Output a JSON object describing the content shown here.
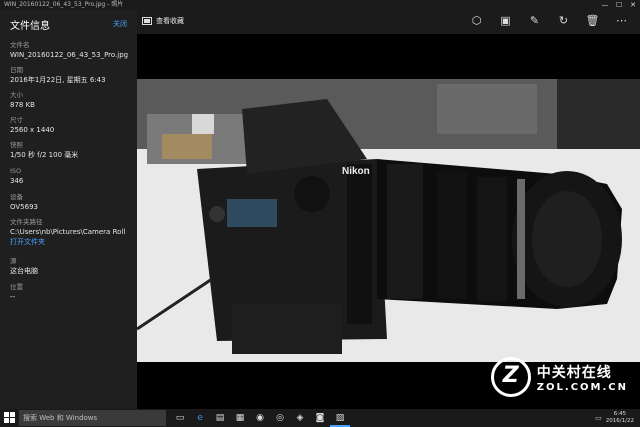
{
  "window": {
    "title": "WIN_20160122_06_43_53_Pro.jpg - 照片",
    "controls": [
      "—",
      "☐",
      "✕"
    ]
  },
  "panel": {
    "title": "文件信息",
    "close_label": "关闭",
    "fields": [
      {
        "key": "文件名",
        "value": "WIN_20160122_06_43_53_Pro.jpg"
      },
      {
        "key": "日期",
        "value": "2016年1月22日, 星期五 6:43"
      },
      {
        "key": "大小",
        "value": "878 KB"
      },
      {
        "key": "尺寸",
        "value": "2560 x 1440"
      },
      {
        "key": "快照",
        "value": "1/50 秒 f/2 100 毫米"
      },
      {
        "key": "ISO",
        "value": "346"
      },
      {
        "key": "设备",
        "value": "OV5693"
      },
      {
        "key": "文件夹路径",
        "value": "C:\\Users\\nb\\Pictures\\Camera Roll",
        "link": "打开文件夹"
      },
      {
        "key": "源",
        "value": "这台电脑"
      },
      {
        "key": "位置",
        "value": "--"
      }
    ]
  },
  "toolbar": {
    "favorite_label": "查看收藏",
    "favorite_icon": "folder-icon",
    "actions": [
      {
        "name": "enhance-icon",
        "glyph": "⬡"
      },
      {
        "name": "slideshow-icon",
        "glyph": "▣"
      },
      {
        "name": "edit-icon",
        "glyph": "✎"
      },
      {
        "name": "rotate-icon",
        "glyph": "↻"
      },
      {
        "name": "delete-icon",
        "glyph": "🗑"
      },
      {
        "name": "more-icon",
        "glyph": "⋯"
      }
    ]
  },
  "watermark": {
    "logo": "Z",
    "cn": "中关村在线",
    "en": "ZOL.COM.CN"
  },
  "taskbar": {
    "search_placeholder": "搜索 Web 和 Windows",
    "apps": [
      {
        "name": "task-view-icon",
        "glyph": "▭"
      },
      {
        "name": "edge-icon",
        "glyph": "e"
      },
      {
        "name": "explorer-icon",
        "glyph": "▤"
      },
      {
        "name": "store-icon",
        "glyph": "▦"
      },
      {
        "name": "app-icon-1",
        "glyph": "◉"
      },
      {
        "name": "app-icon-2",
        "glyph": "◎"
      },
      {
        "name": "app-icon-3",
        "glyph": "◈"
      },
      {
        "name": "camera-icon",
        "glyph": "◙"
      },
      {
        "name": "photos-icon",
        "glyph": "▨"
      }
    ],
    "time": "6:45",
    "date": "2016/1/22"
  }
}
